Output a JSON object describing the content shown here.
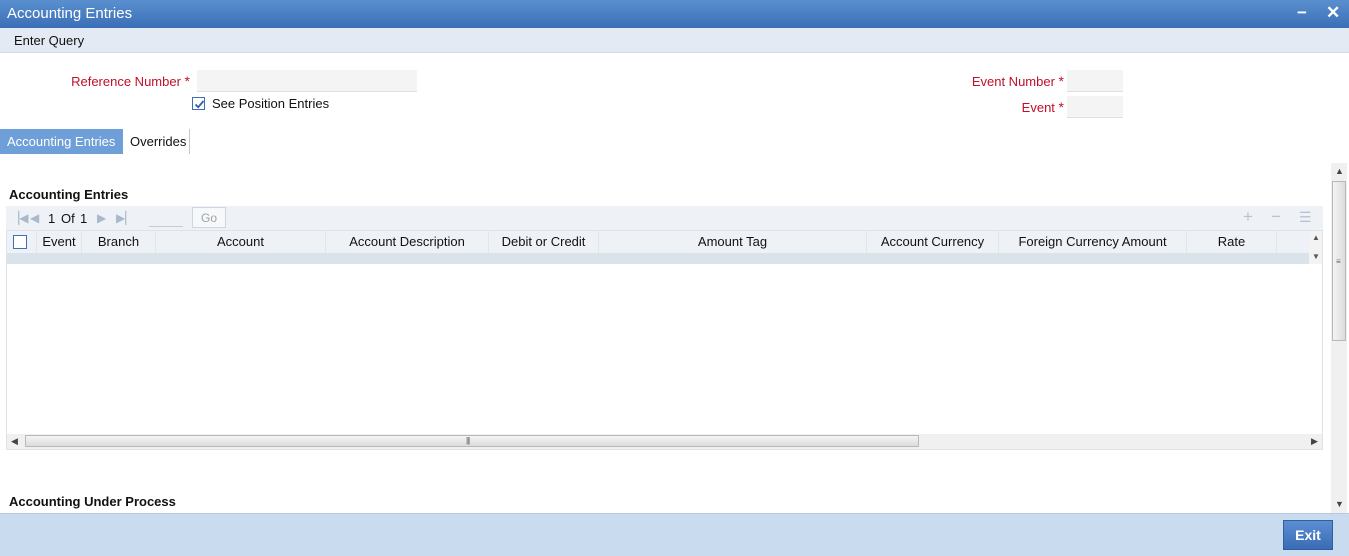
{
  "window": {
    "title": "Accounting Entries",
    "minimize": "−",
    "close": "✕"
  },
  "menu": {
    "enter_query": "Enter Query"
  },
  "form": {
    "reference_number_label": "Reference Number",
    "reference_number_value": "",
    "see_position_entries_label": "See Position Entries",
    "see_position_entries_checked": true,
    "event_number_label": "Event Number",
    "event_number_value": "",
    "event_label": "Event",
    "event_value": "",
    "required_marker": "*"
  },
  "tabs": [
    {
      "label": "Accounting Entries",
      "active": true
    },
    {
      "label": "Overrides",
      "active": false
    }
  ],
  "accounting_entries": {
    "section_title": "Accounting Entries",
    "pager": {
      "current": "1",
      "of_label": "Of",
      "total": "1",
      "go_label": "Go"
    },
    "columns": [
      "Event",
      "Branch",
      "Account",
      "Account Description",
      "Debit or Credit",
      "Amount Tag",
      "Account Currency",
      "Foreign Currency Amount",
      "Rate"
    ]
  },
  "accounting_under_process": {
    "section_title": "Accounting Under Process"
  },
  "footer": {
    "exit_label": "Exit"
  },
  "icons": {
    "first": "first-page-icon",
    "prev": "prev-page-icon",
    "next": "next-page-icon",
    "last": "last-page-icon",
    "add": "add-row-icon",
    "delete": "delete-row-icon",
    "view": "single-view-icon"
  },
  "colors": {
    "title_bar": "#3a6fb7",
    "required_label": "#c0102a",
    "active_tab": "#6f9fd8",
    "footer": "#c9dcef"
  }
}
